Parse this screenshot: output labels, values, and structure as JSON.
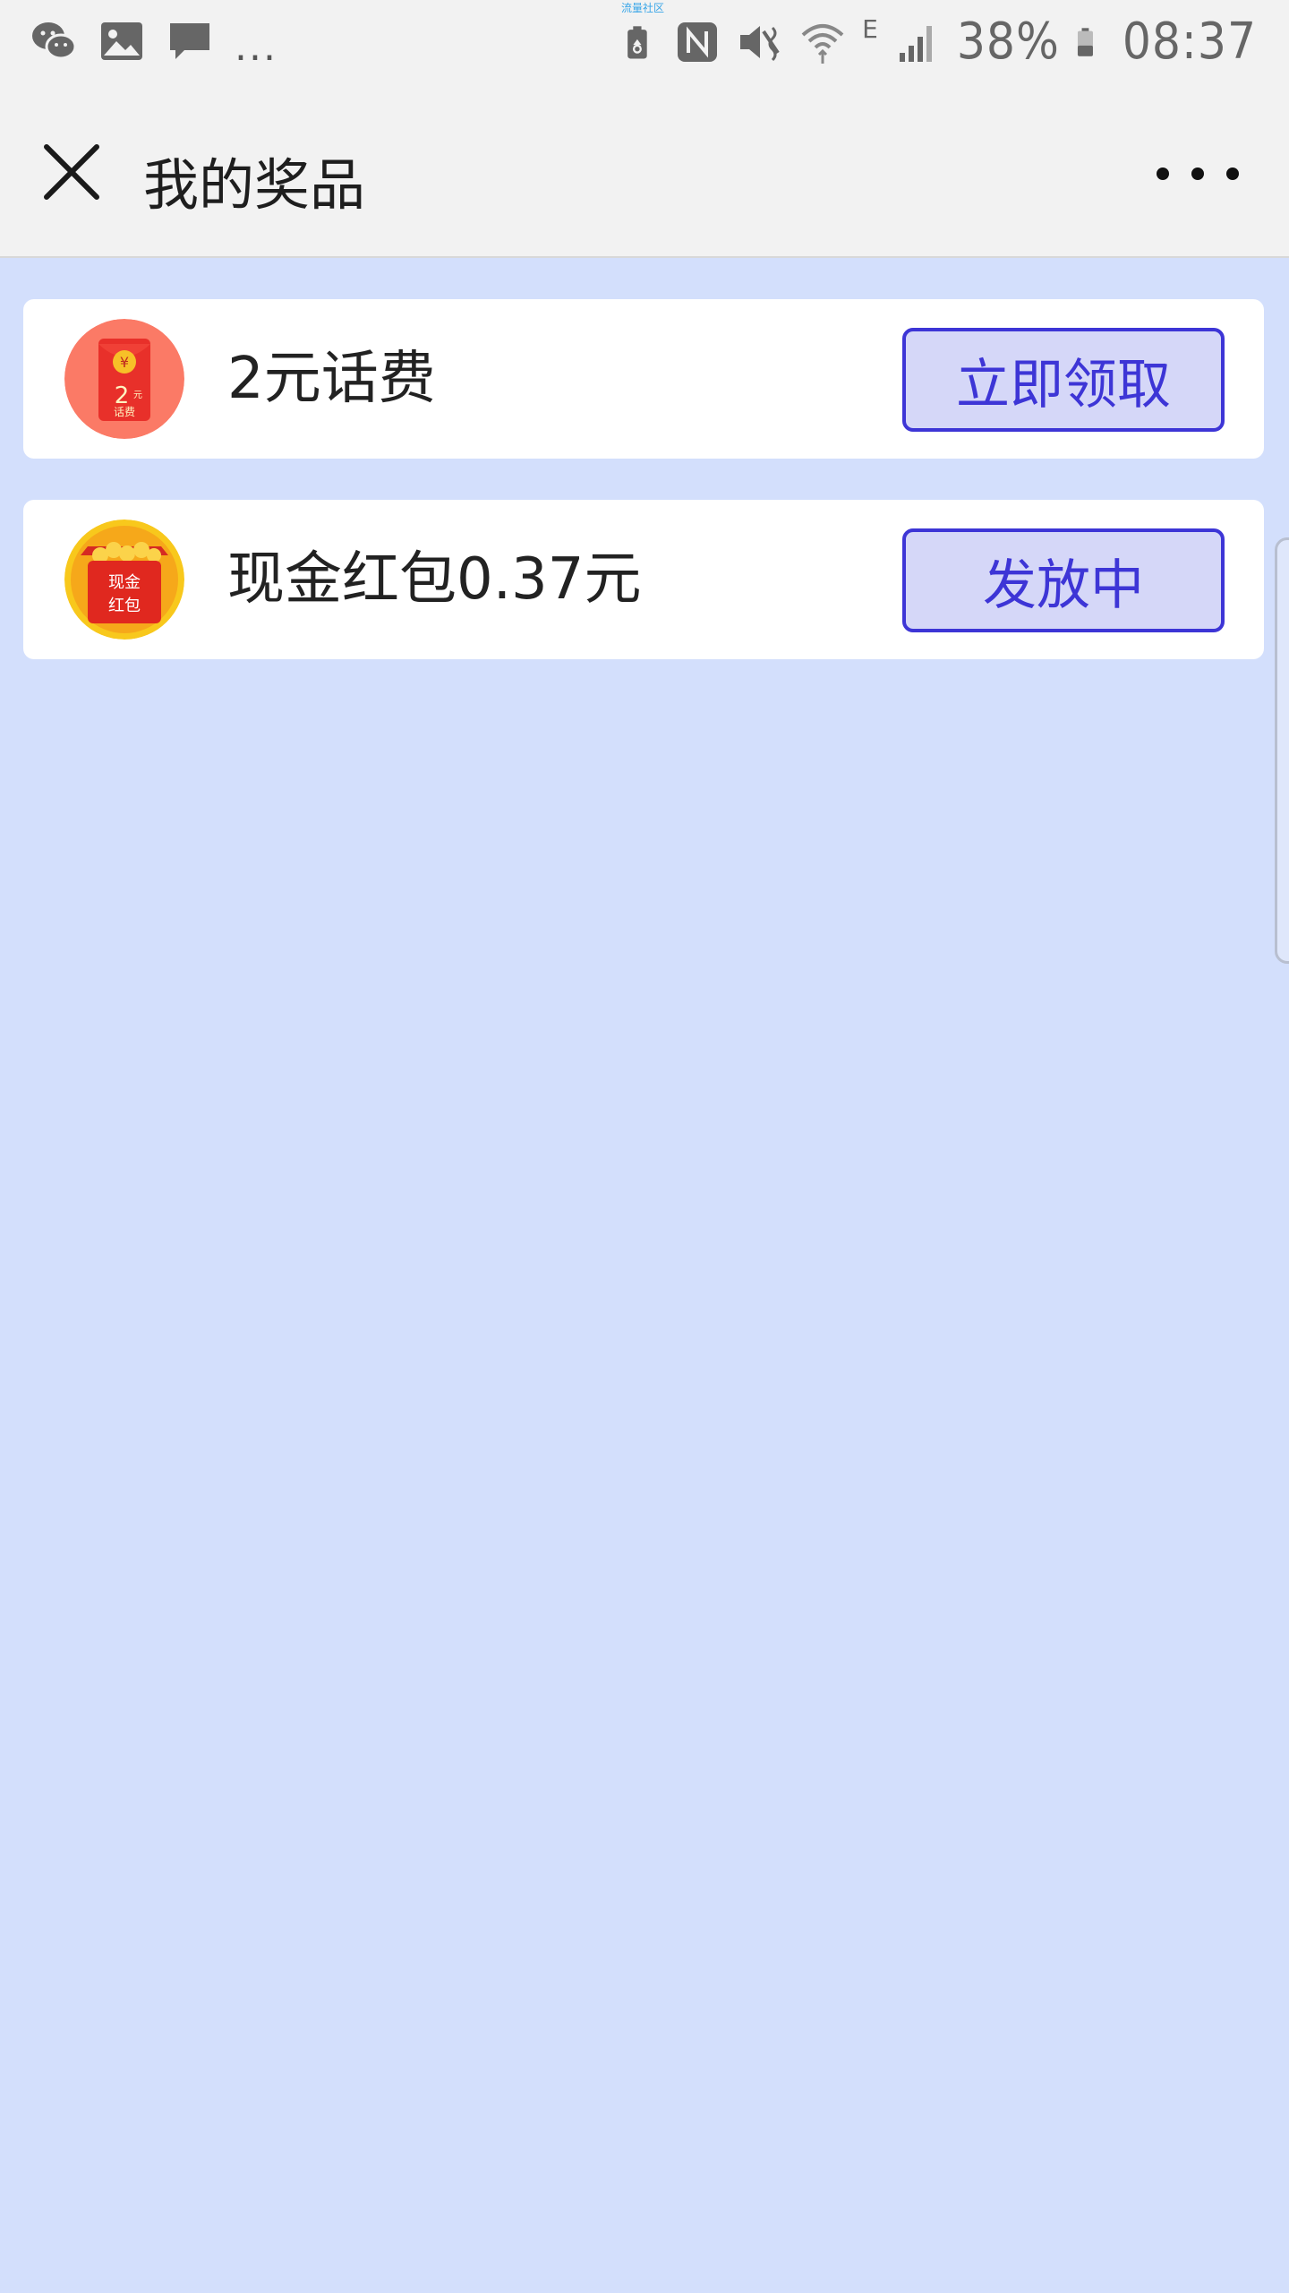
{
  "status_bar": {
    "battery_percent": "38%",
    "time": "08:37",
    "network_label": "E",
    "overflow": "...",
    "tiny_text": "流量社区",
    "left_icons": [
      "wechat-icon",
      "image-icon",
      "message-icon"
    ],
    "right_icons": [
      "battery-saver-icon",
      "nfc-icon",
      "mute-icon",
      "wifi-icon",
      "signal-icon",
      "battery-icon"
    ]
  },
  "header": {
    "title": "我的奖品",
    "close_icon": "close-icon",
    "more_icon": "more-icon"
  },
  "prizes": [
    {
      "name": "2元话费",
      "button_label": "立即领取",
      "icon": "red-packet-phone-credit-icon",
      "icon_text_top": "¥",
      "icon_text_amount": "2",
      "icon_text_unit": "元",
      "icon_text_bottom": "话费"
    },
    {
      "name": "现金红包0.37元",
      "button_label": "发放中",
      "icon": "cash-red-packet-icon",
      "icon_text_line1": "现金",
      "icon_text_line2": "红包"
    }
  ],
  "colors": {
    "background": "#d3dffc",
    "accent": "#3d35d6",
    "button_fill": "#d5d7f8",
    "bar": "#f2f2f2"
  }
}
